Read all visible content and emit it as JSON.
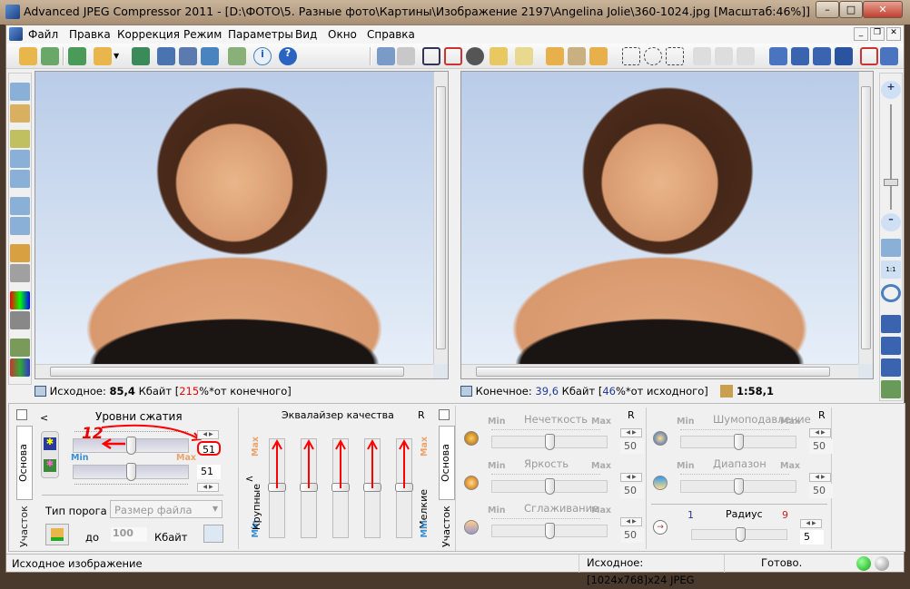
{
  "window": {
    "title": "Advanced JPEG Compressor 2011 - [D:\\ФОТО\\5. Разные фото\\Картины\\Изображение 2197\\Angelina Jolie\\360-1024.jpg  [Масштаб:46%]]"
  },
  "menu": [
    "Файл",
    "Правка",
    "Коррекция",
    "Режим",
    "Параметры",
    "Вид",
    "Окно",
    "Справка"
  ],
  "source_info": {
    "label": "Исходное:",
    "size": "85,4",
    "unit": "Кбайт",
    "open": "[",
    "percent": "215",
    "suffix": "%*от конечного]"
  },
  "result_info": {
    "label": "Конечное:",
    "size": "39,6",
    "unit": "Кбайт",
    "open": "[",
    "percent": "46",
    "suffix": "%*от исходного]",
    "ratio": "1:58,1"
  },
  "tabs": {
    "basic": "Основа",
    "area": "Участок"
  },
  "compression": {
    "title": "Уровни сжатия",
    "back": "<",
    "annotation": "12",
    "min": "Min",
    "max": "Max",
    "value1": "51",
    "value2": "51",
    "level1": 51,
    "level2": 51
  },
  "threshold": {
    "label": "Тип порога",
    "select": "Размер файла",
    "to": "до",
    "value": "100",
    "unit": "Кбайт"
  },
  "equalizer": {
    "title": "Эквалайзер качества",
    "r": "R",
    "coarse": "Крупные",
    "fine": "Мелкие",
    "back": "<",
    "min": "Min",
    "max": "Max"
  },
  "filters": {
    "r": "R",
    "min": "Min",
    "max": "Max",
    "items": [
      {
        "name": "Нечеткость",
        "value": "50"
      },
      {
        "name": "Яркость",
        "value": "50"
      },
      {
        "name": "Сглаживание",
        "value": "50"
      },
      {
        "name": "Шумоподавление",
        "value": "50"
      },
      {
        "name": "Диапазон",
        "value": "50"
      }
    ]
  },
  "radius": {
    "label": "Радиус",
    "min": "1",
    "max": "9",
    "value": "5"
  },
  "status": {
    "left": "Исходное изображение",
    "image": "Исходное: [1024x768]x24 JPEG",
    "state": "Готово."
  }
}
